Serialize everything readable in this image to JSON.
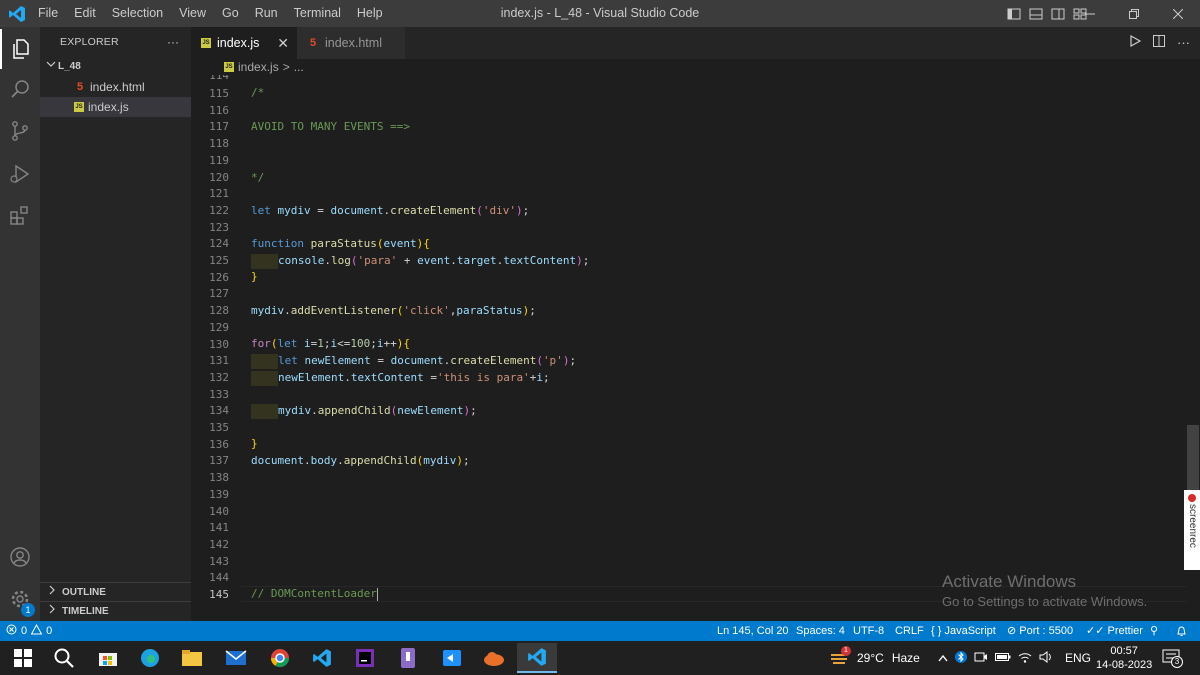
{
  "window": {
    "title": "index.js - L_48 - Visual Studio Code"
  },
  "menu": [
    "File",
    "Edit",
    "Selection",
    "View",
    "Go",
    "Run",
    "Terminal",
    "Help"
  ],
  "sidebar": {
    "header": "EXPLORER",
    "more": "···",
    "folder": "L_48",
    "files": [
      {
        "name": "index.html",
        "type": "html",
        "selected": false
      },
      {
        "name": "index.js",
        "type": "js",
        "selected": true
      }
    ],
    "outline": "OUTLINE",
    "timeline": "TIMELINE"
  },
  "activity": {
    "settings_badge": "1"
  },
  "tabs": [
    {
      "label": "index.js",
      "active": true,
      "icon": "JS"
    },
    {
      "label": "index.html",
      "active": false,
      "icon": "5"
    }
  ],
  "breadcrumb": {
    "file": "index.js",
    "sep": ">",
    "rest": "..."
  },
  "editor": {
    "top_partial_line": "114",
    "current_line": "145",
    "line_numbers": [
      "115",
      "116",
      "117",
      "118",
      "119",
      "120",
      "121",
      "122",
      "123",
      "124",
      "125",
      "126",
      "127",
      "128",
      "129",
      "130",
      "131",
      "132",
      "133",
      "134",
      "135",
      "136",
      "137",
      "138",
      "139",
      "140",
      "141",
      "142",
      "143",
      "144",
      "145"
    ]
  },
  "watermark": {
    "title": "Activate Windows",
    "subtitle": "Go to Settings to activate Windows."
  },
  "screenrec": "screenrec",
  "status": {
    "errors": "0",
    "warnings": "0",
    "position": "Ln 145, Col 20",
    "spaces": "Spaces: 4",
    "encoding": "UTF-8",
    "eol": "CRLF",
    "language": "JavaScript",
    "port": "Port : 5500",
    "prettier": "Prettier"
  },
  "taskbar": {
    "weather_temp": "29°C",
    "weather_text": "Haze",
    "weather_badge": "1",
    "lang": "ENG",
    "time": "00:57",
    "date": "14-08-2023",
    "notif_count": "3"
  },
  "colors": {
    "statusbar": "#007acc",
    "comment": "#6a9955",
    "keyword": "#569cd6",
    "function": "#dcdcaa",
    "variable": "#9cdcfe",
    "string": "#ce9178",
    "number": "#b5cea8",
    "bracket_yellow": "#ffd700",
    "bracket_pink": "#da70d6"
  }
}
